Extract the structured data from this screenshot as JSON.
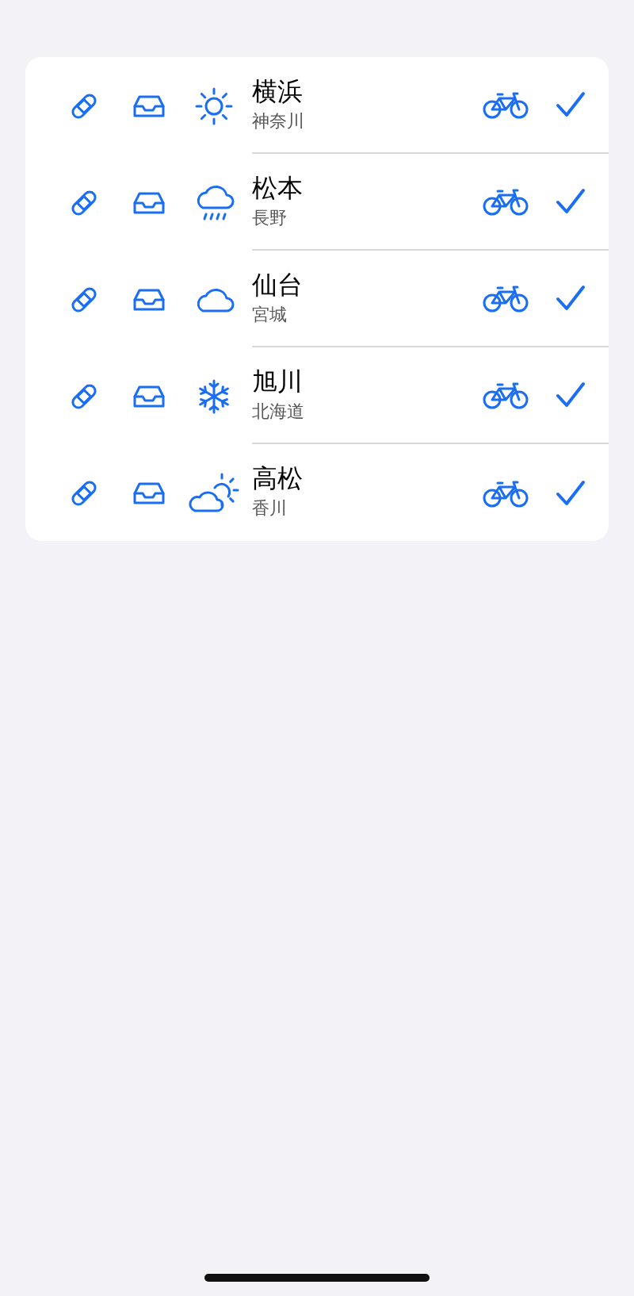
{
  "rows": [
    {
      "kind": "sun",
      "title": "横浜",
      "subtitle": "神奈川",
      "checked": true
    },
    {
      "kind": "rain",
      "title": "松本",
      "subtitle": "長野",
      "checked": true
    },
    {
      "kind": "cloud",
      "title": "仙台",
      "subtitle": "宮城",
      "checked": true
    },
    {
      "kind": "snow",
      "title": "旭川",
      "subtitle": "北海道",
      "checked": true
    },
    {
      "kind": "partly-sunny",
      "title": "高松",
      "subtitle": "香川",
      "checked": true
    }
  ]
}
